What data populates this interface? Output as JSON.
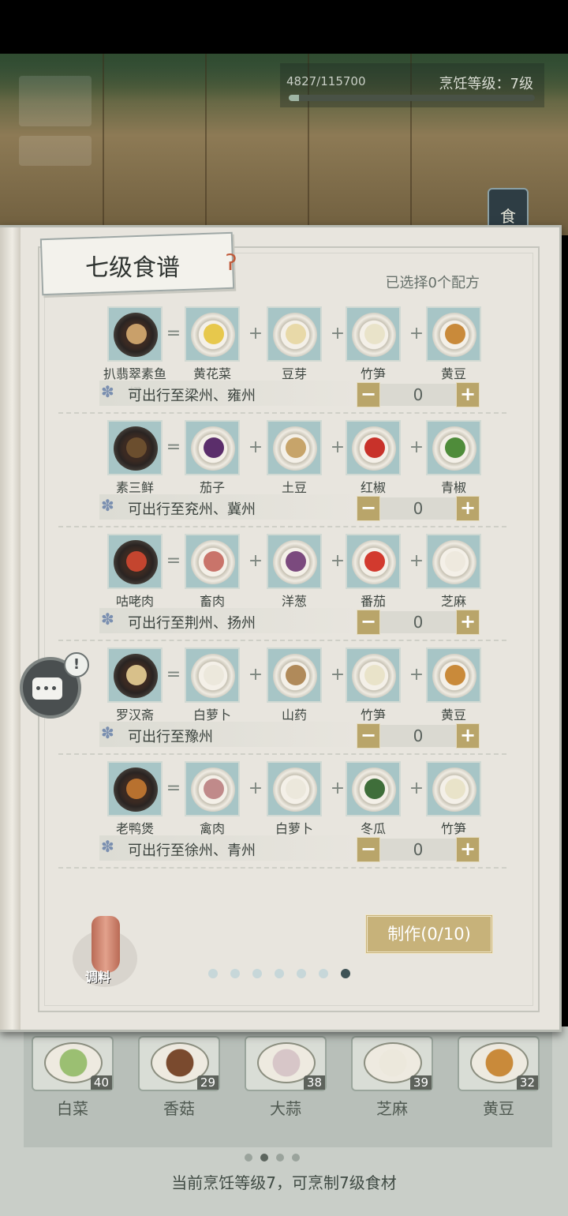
{
  "hud": {
    "xp_text": "4827/115700",
    "xp_progress": 0.042,
    "cooking_level": "烹饪等级：7级",
    "side_tab": "食"
  },
  "book": {
    "title": "七级食谱",
    "selected": "已选择0个配方",
    "make_button": "制作(0/10)",
    "page_count": 7,
    "current_page": 7,
    "seasoning_label": "调料"
  },
  "recipes": [
    {
      "dish": "扒翡翠素鱼翅",
      "ingredients": [
        "黄花菜",
        "豆芽",
        "竹笋",
        "黄豆"
      ],
      "destination": "可出行至梁州、雍州",
      "quantity": "0"
    },
    {
      "dish": "素三鲜",
      "ingredients": [
        "茄子",
        "土豆",
        "红椒",
        "青椒"
      ],
      "destination": "可出行至兖州、冀州",
      "quantity": "0"
    },
    {
      "dish": "咕咾肉",
      "ingredients": [
        "畜肉",
        "洋葱",
        "番茄",
        "芝麻"
      ],
      "destination": "可出行至荆州、扬州",
      "quantity": "0"
    },
    {
      "dish": "罗汉斋",
      "ingredients": [
        "白萝卜",
        "山药",
        "竹笋",
        "黄豆"
      ],
      "destination": "可出行至豫州",
      "quantity": "0"
    },
    {
      "dish": "老鸭煲",
      "ingredients": [
        "禽肉",
        "白萝卜",
        "冬瓜",
        "竹笋"
      ],
      "destination": "可出行至徐州、青州",
      "quantity": "0"
    }
  ],
  "inventory": {
    "items": [
      {
        "name": "白菜",
        "count": "40"
      },
      {
        "name": "香菇",
        "count": "29"
      },
      {
        "name": "大蒜",
        "count": "38"
      },
      {
        "name": "芝麻",
        "count": "39"
      },
      {
        "name": "黄豆",
        "count": "32"
      }
    ],
    "page_count": 4,
    "current_page": 2,
    "note": "当前烹饪等级7，可烹制7级食材"
  }
}
